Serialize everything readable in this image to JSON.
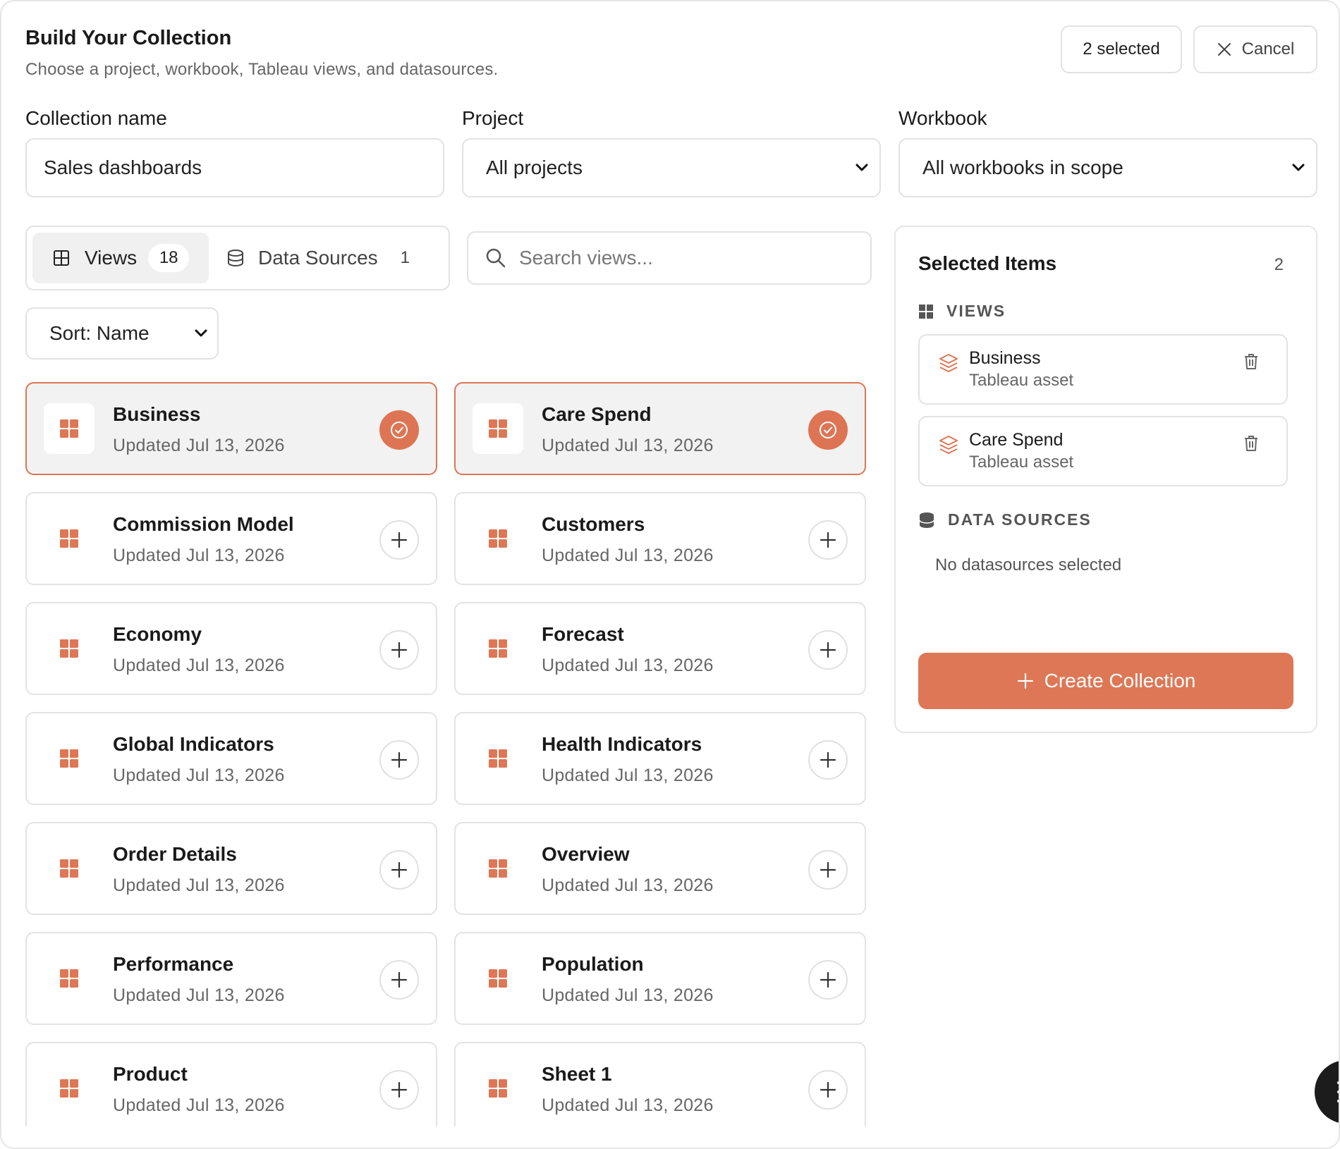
{
  "header": {
    "title": "Build Your Collection",
    "subtitle": "Choose a project, workbook, Tableau views, and datasources.",
    "selected_label": "2 selected",
    "cancel_label": "Cancel"
  },
  "form": {
    "collection_name_label": "Collection name",
    "collection_name_value": "Sales dashboards",
    "project_label": "Project",
    "project_value": "All projects",
    "workbook_label": "Workbook",
    "workbook_value": "All workbooks in scope"
  },
  "tabs": {
    "views_label": "Views",
    "views_count": "18",
    "datasources_label": "Data Sources",
    "datasources_count": "1"
  },
  "search": {
    "placeholder": "Search views..."
  },
  "sort": {
    "value": "Sort: Name"
  },
  "views": [
    {
      "name": "Business",
      "date": "Updated Jul 13, 2026",
      "selected": true
    },
    {
      "name": "Care Spend",
      "date": "Updated Jul 13, 2026",
      "selected": true
    },
    {
      "name": "Commission Model",
      "date": "Updated Jul 13, 2026",
      "selected": false
    },
    {
      "name": "Customers",
      "date": "Updated Jul 13, 2026",
      "selected": false
    },
    {
      "name": "Economy",
      "date": "Updated Jul 13, 2026",
      "selected": false
    },
    {
      "name": "Forecast",
      "date": "Updated Jul 13, 2026",
      "selected": false
    },
    {
      "name": "Global Indicators",
      "date": "Updated Jul 13, 2026",
      "selected": false
    },
    {
      "name": "Health Indicators",
      "date": "Updated Jul 13, 2026",
      "selected": false
    },
    {
      "name": "Order Details",
      "date": "Updated Jul 13, 2026",
      "selected": false
    },
    {
      "name": "Overview",
      "date": "Updated Jul 13, 2026",
      "selected": false
    },
    {
      "name": "Performance",
      "date": "Updated Jul 13, 2026",
      "selected": false
    },
    {
      "name": "Population",
      "date": "Updated Jul 13, 2026",
      "selected": false
    },
    {
      "name": "Product",
      "date": "Updated Jul 13, 2026",
      "selected": false
    },
    {
      "name": "Sheet 1",
      "date": "Updated Jul 13, 2026",
      "selected": false
    }
  ],
  "sidebar": {
    "title": "Selected Items",
    "count": "2",
    "views_heading": "VIEWS",
    "selected_views": [
      {
        "name": "Business",
        "type": "Tableau asset"
      },
      {
        "name": "Care Spend",
        "type": "Tableau asset"
      }
    ],
    "datasources_heading": "DATA SOURCES",
    "datasources_empty": "No datasources selected",
    "create_label": "Create Collection"
  },
  "colors": {
    "accent": "#de7755",
    "border": "#e3e3e3",
    "muted_text": "#666666"
  },
  "icons": [
    "close-icon",
    "grid-icon",
    "database-icon",
    "search-icon",
    "chevron-down-icon",
    "view-tile-icon",
    "check-icon",
    "plus-icon",
    "layers-icon",
    "trash-icon",
    "menu-icon"
  ]
}
